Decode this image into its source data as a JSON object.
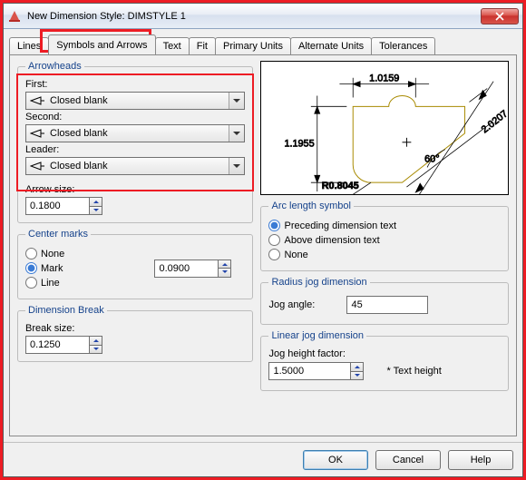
{
  "window": {
    "title": "New Dimension Style: DIMSTYLE 1"
  },
  "tabs": {
    "lines": "Lines",
    "symbols": "Symbols and Arrows",
    "text": "Text",
    "fit": "Fit",
    "primary": "Primary Units",
    "alternate": "Alternate Units",
    "tolerances": "Tolerances"
  },
  "arrowheads": {
    "legend": "Arrowheads",
    "first_label": "First:",
    "first_value": "Closed blank",
    "second_label": "Second:",
    "second_value": "Closed blank",
    "leader_label": "Leader:",
    "leader_value": "Closed blank",
    "size_label": "Arrow size:",
    "size_value": "0.1800"
  },
  "center": {
    "legend": "Center marks",
    "none": "None",
    "mark": "Mark",
    "line": "Line",
    "value": "0.0900"
  },
  "dimbreak": {
    "legend": "Dimension Break",
    "label": "Break size:",
    "value": "0.1250"
  },
  "preview": {
    "d1": "1.0159",
    "d2": "1.1955",
    "d3": "2.0207",
    "ang": "60°",
    "rad": "R0.8045"
  },
  "arc": {
    "legend": "Arc length symbol",
    "preceding": "Preceding dimension text",
    "above": "Above dimension text",
    "none": "None"
  },
  "radjog": {
    "legend": "Radius jog dimension",
    "label": "Jog angle:",
    "value": "45"
  },
  "linjog": {
    "legend": "Linear jog dimension",
    "label": "Jog height factor:",
    "value": "1.5000",
    "suffix": "* Text height"
  },
  "buttons": {
    "ok": "OK",
    "cancel": "Cancel",
    "help": "Help"
  }
}
